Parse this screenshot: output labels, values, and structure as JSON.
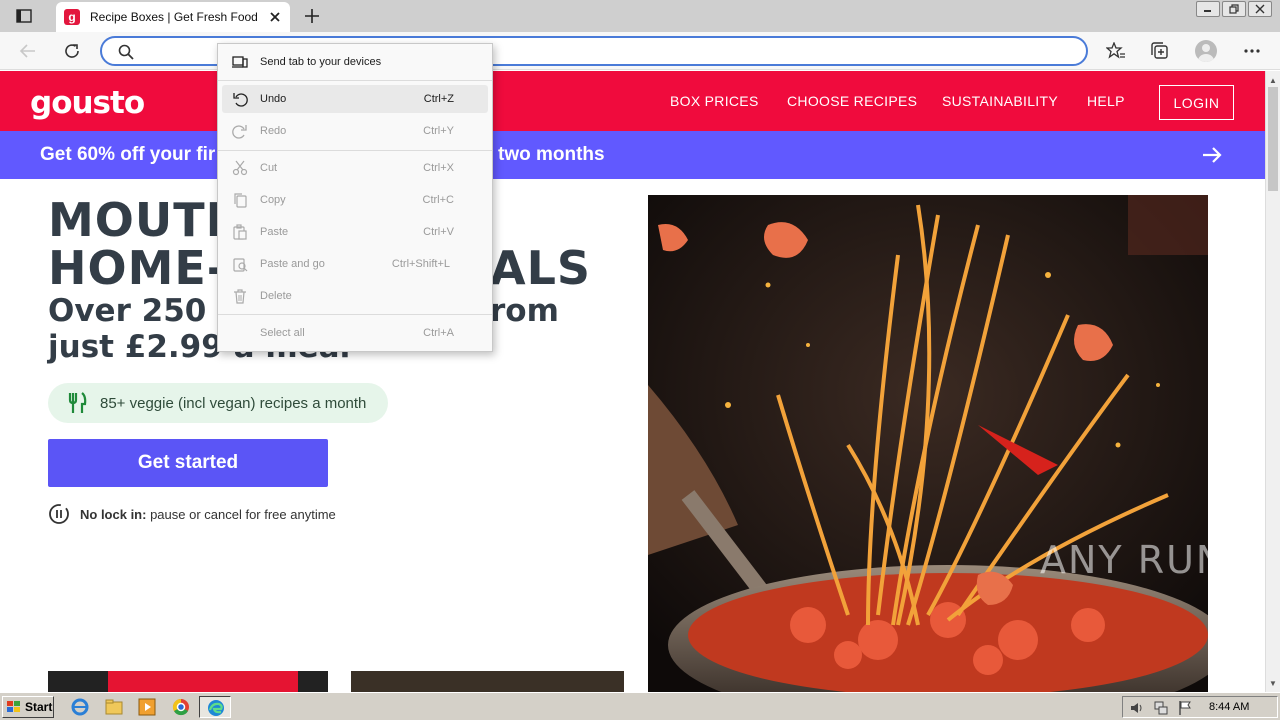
{
  "browser": {
    "tab_title": "Recipe Boxes | Get Fresh Food & Recipes Delivered",
    "favicon_letter": "g",
    "address_value": ""
  },
  "site": {
    "logo": "gousto",
    "nav": [
      "BOX PRICES",
      "CHOOSE RECIPES",
      "SUSTAINABILITY",
      "HELP"
    ],
    "login": "LOGIN",
    "promo_left": "Get 60% off your fir",
    "promo_right": "two months",
    "hero_line1": "MOUTH",
    "hero_line2": "HOME-C",
    "hero_line2_end": "ALS",
    "sub_line1": "Over 250 re",
    "sub_line1_end": "rom",
    "sub_line2": "just £2.99 a meal",
    "veggie": "85+ veggie (incl vegan) recipes a month",
    "cta": "Get started",
    "nolock_bold": "No lock in:",
    "nolock_text": " pause or cancel for free anytime"
  },
  "context_menu": {
    "items": [
      {
        "label": "Send tab to your devices",
        "shortcut": "",
        "icon": "devices-icon",
        "disabled": false
      },
      {
        "label": "Undo",
        "shortcut": "Ctrl+Z",
        "icon": "undo-icon",
        "disabled": false
      },
      {
        "label": "Redo",
        "shortcut": "Ctrl+Y",
        "icon": "redo-icon",
        "disabled": true
      },
      {
        "label": "Cut",
        "shortcut": "Ctrl+X",
        "icon": "cut-icon",
        "disabled": true
      },
      {
        "label": "Copy",
        "shortcut": "Ctrl+C",
        "icon": "copy-icon",
        "disabled": true
      },
      {
        "label": "Paste",
        "shortcut": "Ctrl+V",
        "icon": "paste-icon",
        "disabled": true
      },
      {
        "label": "Paste and go",
        "shortcut": "Ctrl+Shift+L",
        "icon": "paste-go-icon",
        "disabled": true
      },
      {
        "label": "Delete",
        "shortcut": "",
        "icon": "delete-icon",
        "disabled": true
      },
      {
        "label": "Select all",
        "shortcut": "Ctrl+A",
        "icon": "",
        "disabled": true
      }
    ]
  },
  "watermark": "ANY RUN",
  "taskbar": {
    "start": "Start",
    "clock": "8:44 AM"
  },
  "colors": {
    "brand_red": "#f00b3d",
    "promo_purple": "#6159ff",
    "cta_purple": "#5b55f6"
  }
}
